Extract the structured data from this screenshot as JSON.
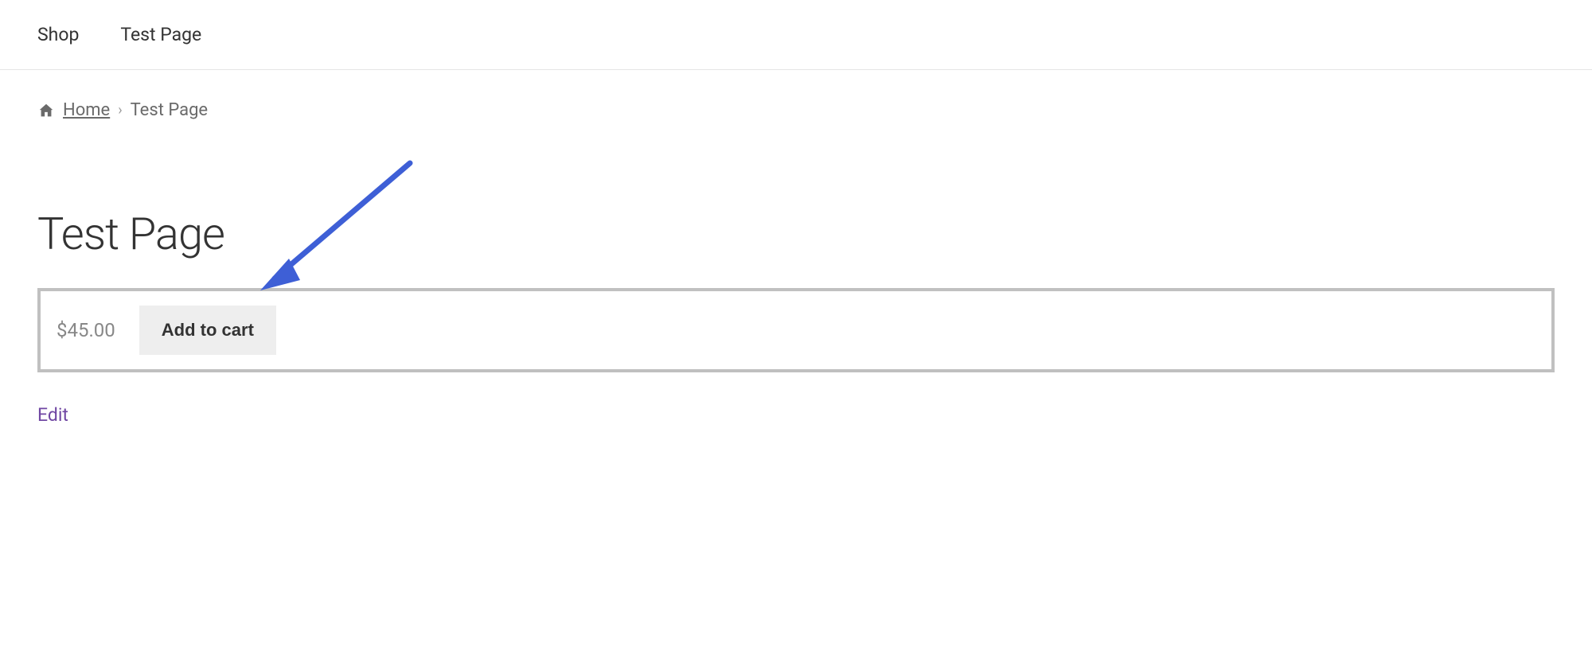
{
  "nav": {
    "items": [
      {
        "label": "Shop"
      },
      {
        "label": "Test Page"
      }
    ]
  },
  "breadcrumb": {
    "home_label": "Home",
    "current": "Test Page"
  },
  "page": {
    "title": "Test Page"
  },
  "product": {
    "price": "$45.00",
    "add_to_cart_label": "Add to cart"
  },
  "edit": {
    "label": "Edit"
  },
  "annotation": {
    "arrow_color": "#3e5fd6"
  }
}
